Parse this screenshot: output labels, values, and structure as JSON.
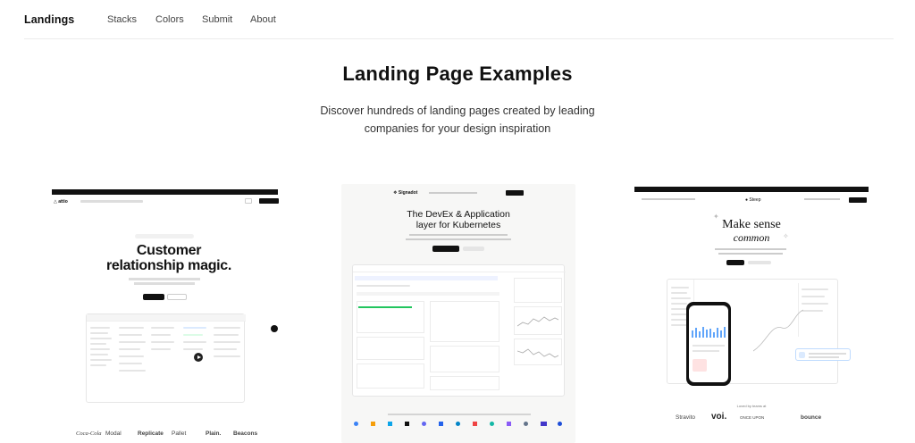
{
  "nav": {
    "brand": "Landings",
    "links": [
      "Stacks",
      "Colors",
      "Submit",
      "About"
    ]
  },
  "hero": {
    "title": "Landing Page Examples",
    "subtitle": "Discover hundreds of landing pages created by leading companies for your design inspiration"
  },
  "cards": [
    {
      "name": "attio",
      "headline_line1": "Customer",
      "headline_line2": "relationship magic.",
      "logos": [
        "Coca-Cola",
        "Modal",
        "Replicate",
        "Pallet",
        "Plain.",
        "Beacons"
      ]
    },
    {
      "name": "Signadot",
      "headline_line1": "The DevEx & Application",
      "headline_line2": "layer for Kubernetes"
    },
    {
      "name": "Steep",
      "headline_line1": "Make sense",
      "headline_line2": "common",
      "logos_caption": "Loved by teams at",
      "logos": [
        "Stravito",
        "voi.",
        "ONCE UPON",
        "bounce"
      ]
    }
  ],
  "colors": {
    "text": "#111111",
    "muted": "#444444",
    "rule": "#ececec"
  }
}
